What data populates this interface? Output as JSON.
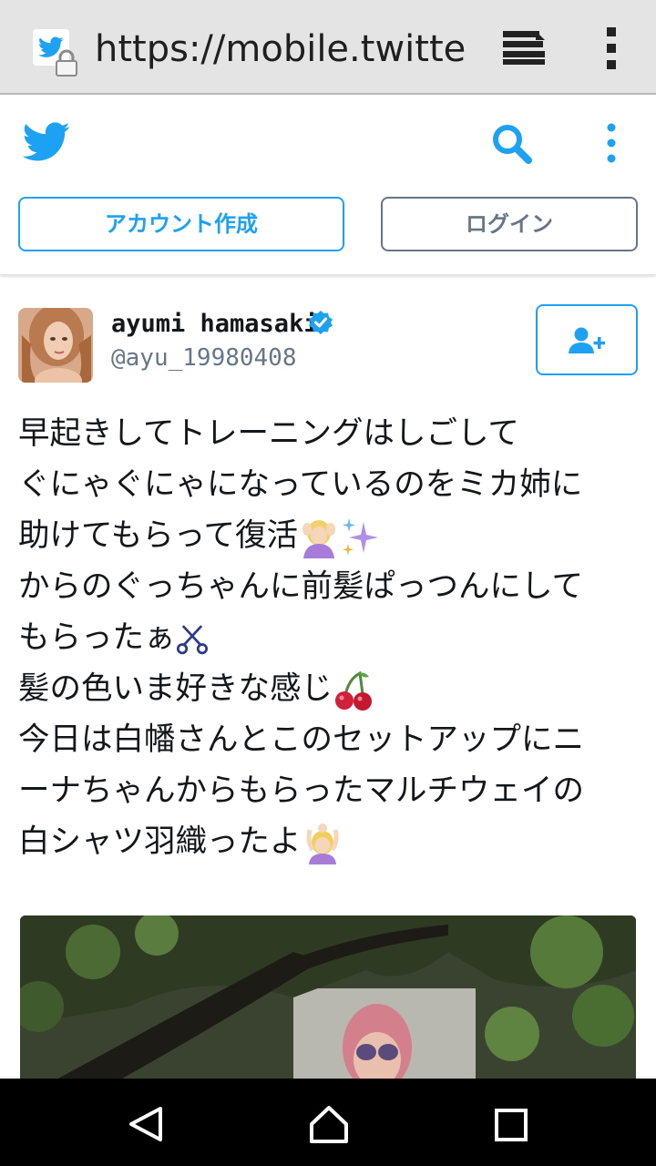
{
  "browser": {
    "url": "https://mobile.twitter.c",
    "favicon": "twitter-bird-icon",
    "lock": "lock-icon",
    "tabs_icon": "tabs-icon",
    "menu_icon": "overflow-menu-icon"
  },
  "header": {
    "logo": "twitter-bird-icon",
    "search_icon": "search-icon",
    "more_icon": "more-vertical-icon",
    "signup_label": "アカウント作成",
    "login_label": "ログイン"
  },
  "tweet": {
    "user_name": "ayumi hamasaki",
    "verified": true,
    "handle": "@ayu_19980408",
    "follow_icon": "add-user-icon",
    "lines": [
      "早起きしてトレーニングはしごして",
      "ぐにゃぐにゃになっているのをミカ姉に",
      "助けてもらって復活",
      "からのぐっちゃんに前髪ぱっつんにして",
      "もらったぁ",
      "髪の色いま好きな感じ",
      "今日は白幡さんとこのセットアップにニ",
      "ーナちゃんからもらったマルチウェイの",
      "白シャツ羽織ったよ"
    ],
    "emojis": [
      "hair-salon-emoji",
      "sparkles-emoji",
      "scissors-emoji",
      "cherries-emoji",
      "raising-hands-emoji"
    ]
  },
  "nav": {
    "back_icon": "back-triangle-icon",
    "home_icon": "home-icon",
    "recents_icon": "recents-square-icon"
  },
  "colors": {
    "twitter_blue": "#1da1f2",
    "gray_text": "#657786",
    "text": "#14171a",
    "chrome_bg": "#e4e4e4"
  }
}
